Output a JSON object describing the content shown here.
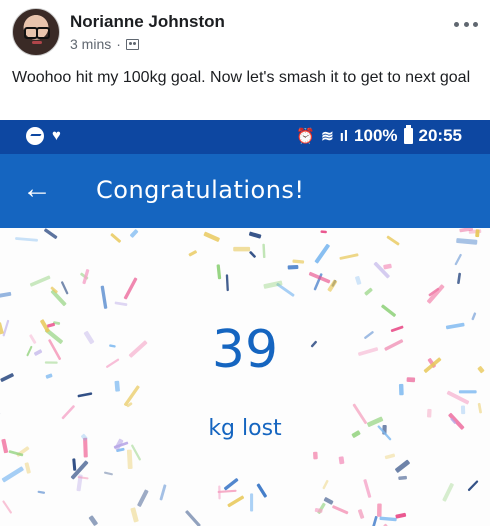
{
  "post": {
    "author": "Norianne Johnston",
    "time": "3 mins",
    "separator": "·",
    "audience_icon": "group-icon",
    "text": "Woohoo hit my 100kg goal. Now let's smash it to get to next goal"
  },
  "phone": {
    "status_bar": {
      "battery": "100%",
      "clock": "20:55",
      "icons": [
        "messenger-icon",
        "heart-icon",
        "alarm-icon",
        "wifi-icon",
        "signal-icon",
        "battery-icon"
      ]
    },
    "app_bar": {
      "title": "Congratulations!",
      "back_icon": "back-arrow-icon"
    },
    "result": {
      "value": "39",
      "unit": "kg lost"
    },
    "colors": {
      "status_bar": "#0d47a1",
      "app_bar": "#1565c0",
      "accent": "#1565c0"
    }
  }
}
